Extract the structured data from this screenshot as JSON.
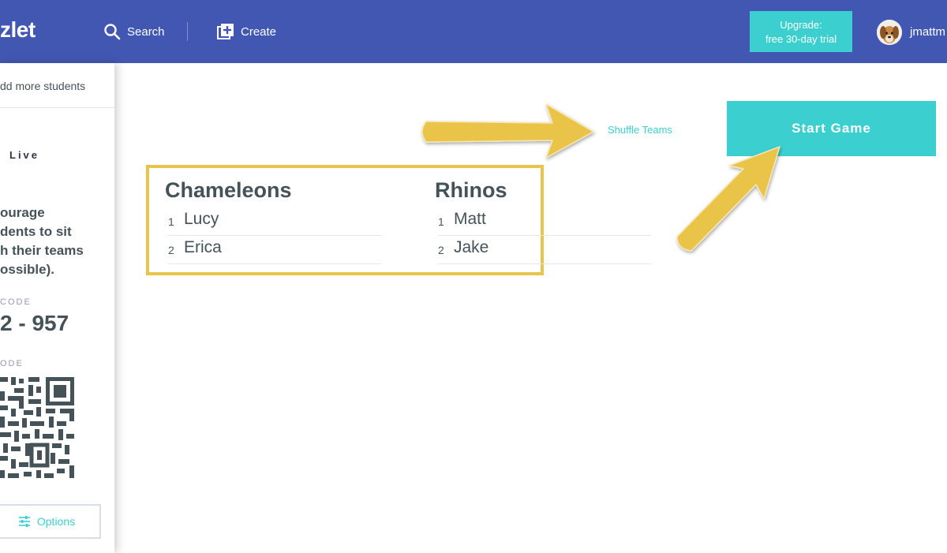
{
  "header": {
    "logo_text": "zlet",
    "search_label": "Search",
    "create_label": "Create",
    "upgrade_line1": "Upgrade:",
    "upgrade_line2": "free 30-day trial",
    "username": "jmattm"
  },
  "sidebar": {
    "add_students_label": "dd more students",
    "live_label": "Live",
    "encourage_lines": [
      "ourage",
      "dents to sit",
      "h their teams",
      "ossible)."
    ],
    "join_code_label": "CODE",
    "join_code_value": "2 - 957",
    "qr_label": "ODE",
    "options_label": "Options"
  },
  "main": {
    "shuffle_label": "Shuffle Teams",
    "start_label": "Start Game",
    "teams": [
      {
        "name": "Chameleons",
        "members": [
          {
            "num": "1",
            "name": "Lucy"
          },
          {
            "num": "2",
            "name": "Erica"
          }
        ]
      },
      {
        "name": "Rhinos",
        "members": [
          {
            "num": "1",
            "name": "Matt"
          },
          {
            "num": "2",
            "name": "Jake"
          }
        ]
      }
    ]
  },
  "colors": {
    "header_bg": "#4257b2",
    "accent_teal": "#3ccfcf",
    "annotation_yellow": "#eac34a",
    "text_dark": "#455358"
  },
  "icons": [
    "search-icon",
    "create-icon",
    "avatar",
    "options-icon",
    "qr-code"
  ]
}
